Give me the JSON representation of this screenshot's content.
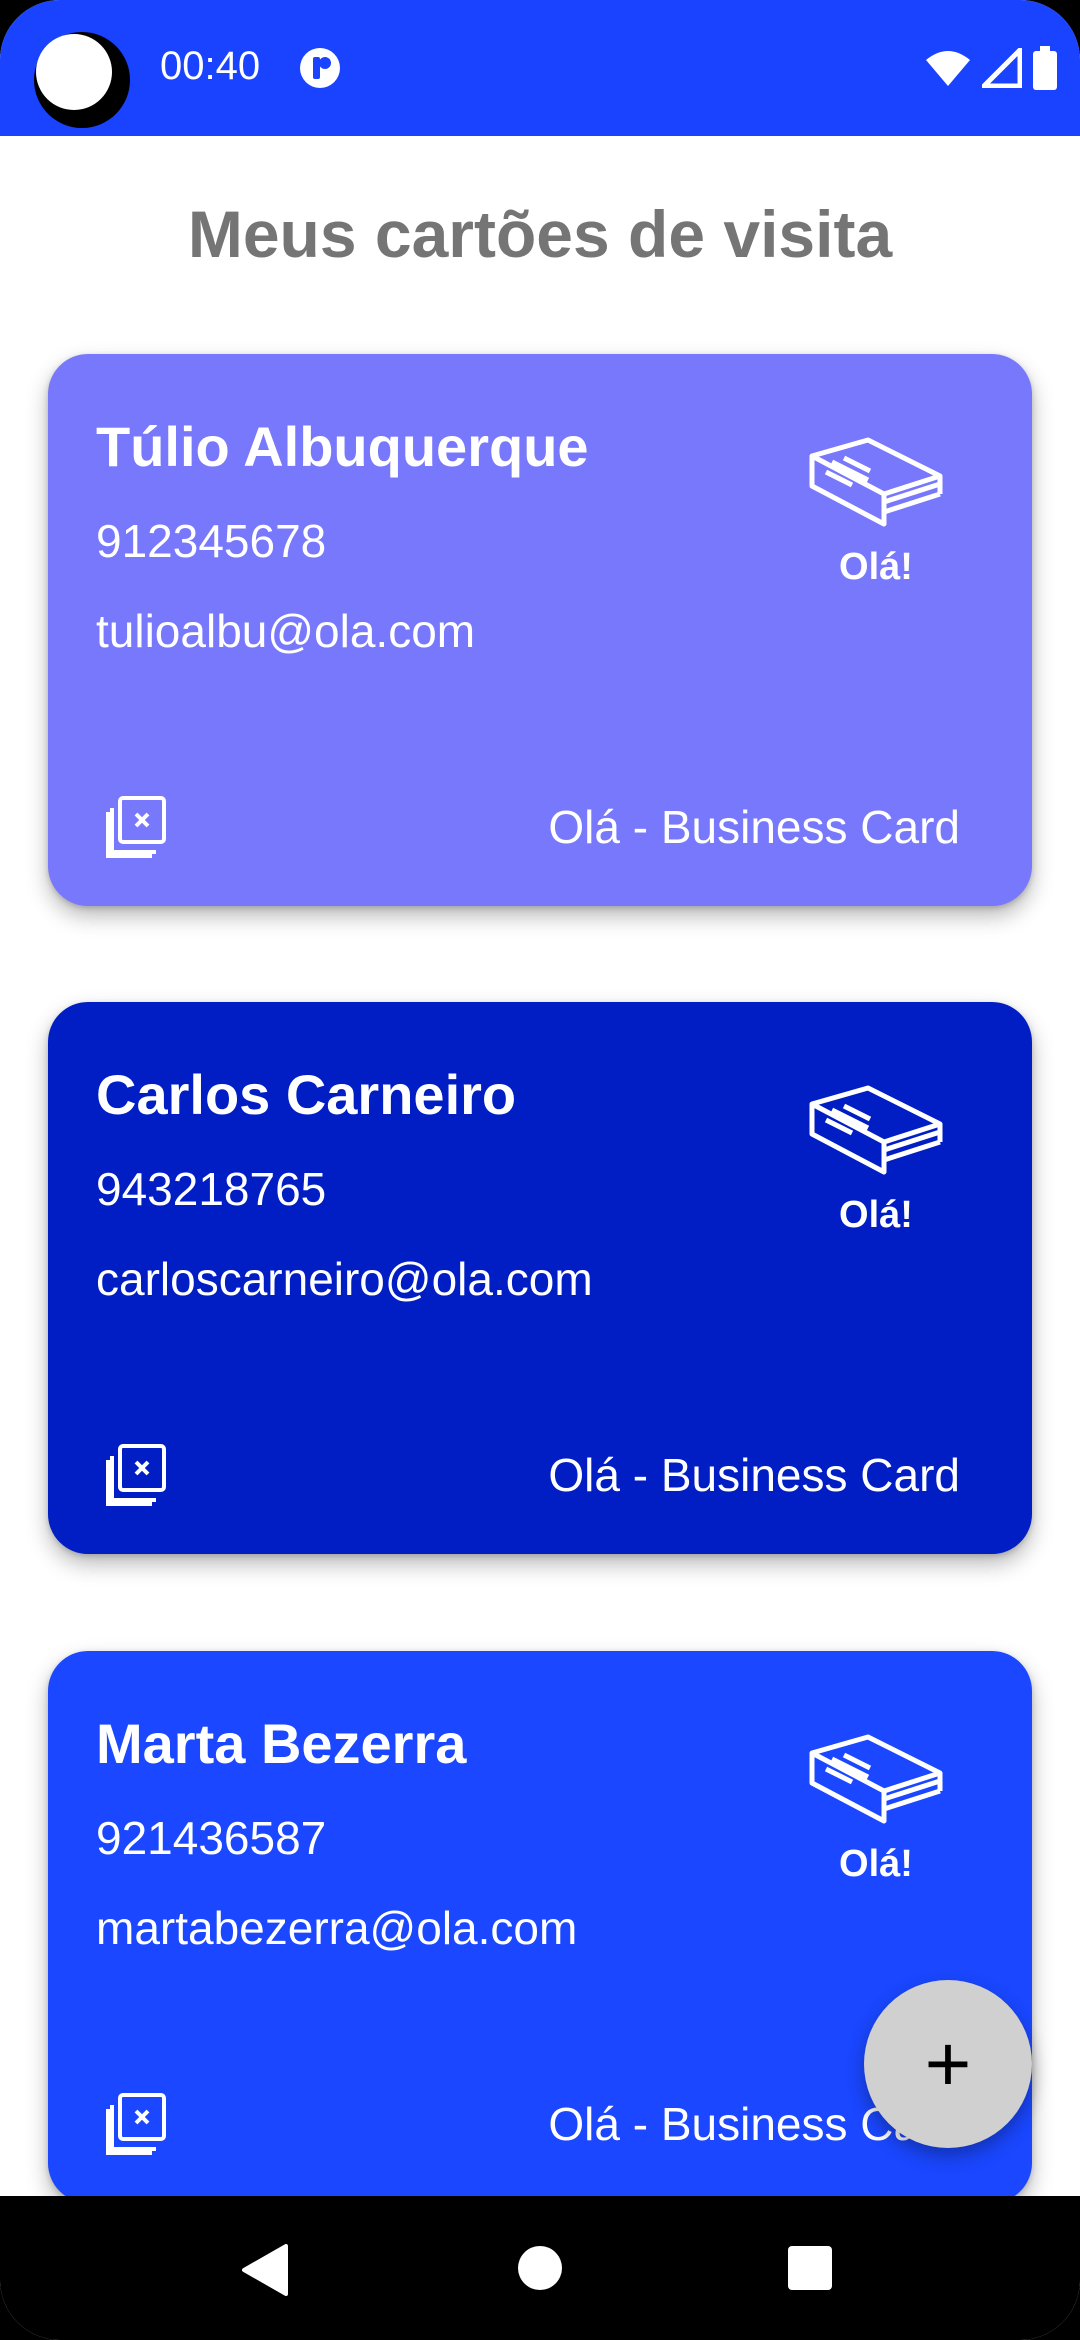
{
  "status_bar": {
    "time": "00:40",
    "color": "#1a43ff",
    "icons": [
      "app-notification-icon",
      "wifi-icon",
      "cell-signal-icon",
      "battery-icon"
    ]
  },
  "page": {
    "title": "Meus cartões de visita"
  },
  "cards": [
    {
      "name": "Túlio Albuquerque",
      "phone": "912345678",
      "email": "tulioalbu@ola.com",
      "logo_text": "Olá!",
      "footer": "Olá - Business Card",
      "color": "#7878fc"
    },
    {
      "name": "Carlos Carneiro",
      "phone": "943218765",
      "email": "carloscarneiro@ola.com",
      "logo_text": "Olá!",
      "footer": "Olá - Business Card",
      "color": "#001ec4"
    },
    {
      "name": "Marta Bezerra",
      "phone": "921436587",
      "email": "martabezerra@ola.com",
      "logo_text": "Olá!",
      "footer": "Olá - Business Card",
      "color": "#1a47ff"
    }
  ],
  "fab": {
    "icon": "plus-icon",
    "label": "+"
  },
  "nav_bar": {
    "icons": [
      "back-icon",
      "home-icon",
      "recents-icon"
    ]
  }
}
